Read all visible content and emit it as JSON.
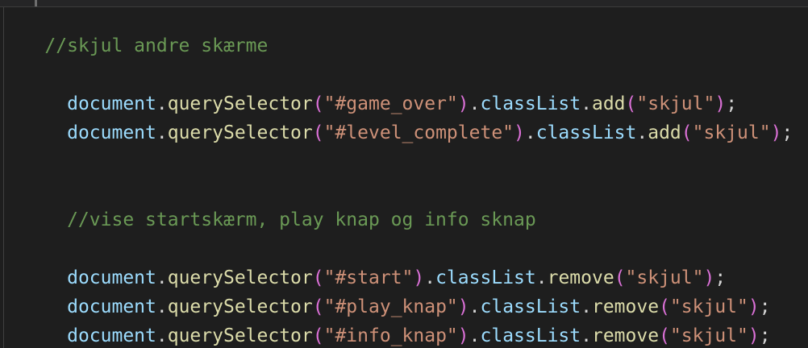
{
  "lines": [
    {
      "comment": "//skjul andre skærme"
    },
    {
      "indent": "  ",
      "obj": "document",
      "method": "querySelector",
      "arg": "\"#game_over\"",
      "prop": "classList",
      "action": "add",
      "value": "\"skjul\""
    },
    {
      "indent": "  ",
      "obj": "document",
      "method": "querySelector",
      "arg": "\"#level_complete\"",
      "prop": "classList",
      "action": "add",
      "value": "\"skjul\""
    },
    {
      "comment": "  //vise startskærm, play knap og info sknap"
    },
    {
      "indent": "  ",
      "obj": "document",
      "method": "querySelector",
      "arg": "\"#start\"",
      "prop": "classList",
      "action": "remove",
      "value": "\"skjul\""
    },
    {
      "indent": "  ",
      "obj": "document",
      "method": "querySelector",
      "arg": "\"#play_knap\"",
      "prop": "classList",
      "action": "remove",
      "value": "\"skjul\""
    },
    {
      "indent": "  ",
      "obj": "document",
      "method": "querySelector",
      "arg": "\"#info_knap\"",
      "prop": "classList",
      "action": "remove",
      "value": "\"skjul\""
    }
  ],
  "syntax": {
    ".": ".",
    "(": "(",
    ")": ")",
    ";": ";"
  },
  "colors": {
    "background": "#1e1e1e",
    "comment": "#6a9955",
    "variable": "#9cdcfe",
    "function": "#dcdcaa",
    "string": "#ce9178",
    "bracket": "#da70d6"
  }
}
